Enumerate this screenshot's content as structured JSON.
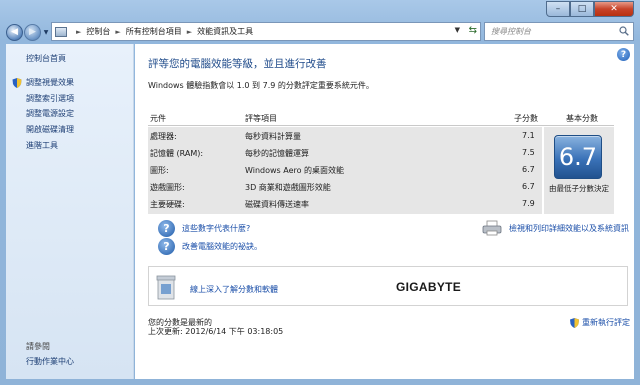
{
  "window": {
    "minimize": "–",
    "maximize": "□",
    "close": "✕"
  },
  "nav": {
    "back": "◀",
    "forward": "▶",
    "breadcrumbs": [
      "控制台",
      "所有控制台項目",
      "效能資訊及工具"
    ],
    "search_placeholder": "搜尋控制台"
  },
  "sidebar": {
    "home": "控制台首頁",
    "items": [
      {
        "label": "調整視覺效果",
        "icon": "shield-icon"
      },
      {
        "label": "調整索引選項",
        "icon": ""
      },
      {
        "label": "調整電源設定",
        "icon": ""
      },
      {
        "label": "開啟磁碟清理",
        "icon": ""
      },
      {
        "label": "進階工具",
        "icon": ""
      }
    ],
    "see_also": "請參閱",
    "action_center": "行動作業中心"
  },
  "main": {
    "help": "?",
    "heading": "評等您的電腦效能等級，並且進行改善",
    "description": "Windows 體驗指數會以 1.0 到 7.9 的分數評定重要系統元件。",
    "table": {
      "col_component": "元件",
      "col_item": "評等項目",
      "col_subscore": "子分數",
      "col_basescore": "基本分數",
      "rows": [
        {
          "component": "處理器:",
          "item": "每秒資料計算量",
          "subscore": "7.1"
        },
        {
          "component": "記憶體 (RAM):",
          "item": "每秒的記憶體運算",
          "subscore": "7.5"
        },
        {
          "component": "圖形:",
          "item": "Windows Aero 的桌面效能",
          "subscore": "6.7"
        },
        {
          "component": "遊戲圖形:",
          "item": "3D 商業和遊戲圖形效能",
          "subscore": "6.7"
        },
        {
          "component": "主要硬碟:",
          "item": "磁碟資料傳送速率",
          "subscore": "7.9"
        }
      ],
      "base_score": "6.7",
      "base_note": "由最低子分數決定"
    },
    "link_numbers": "這些數字代表什麼?",
    "link_improve": "改善電腦效能的祕訣。",
    "link_print": "檢視和列印詳細效能以及系統資訊",
    "banner_link": "線上深入了解分數和軟體",
    "brand": "GIGABYTE",
    "status_current": "您的分數是最新的",
    "status_updated": "上次更新: 2012/6/14 下午 03:18:05",
    "rerun": "重新執行評定"
  }
}
